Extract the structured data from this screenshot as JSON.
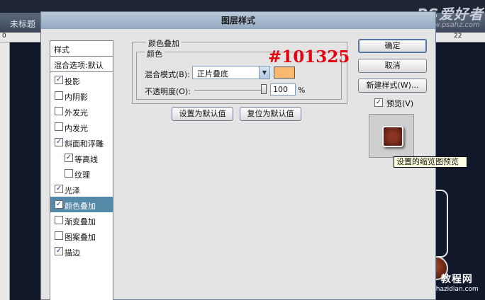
{
  "background": {
    "tab_title": "未标题",
    "ruler_left_mark": "0",
    "ruler_right_mark": "22",
    "logo_text": "PS爱好者",
    "logo_sub": "www.psahz.com",
    "watermark_line1": "查字典 教程网",
    "watermark_line2": "jiaocheng.chazidian.com"
  },
  "dialog": {
    "title": "图层样式",
    "style_list": {
      "header": "样式",
      "blend_options": "混合选项:默认",
      "items": [
        {
          "label": "投影",
          "checked": true,
          "sub": false,
          "selected": false
        },
        {
          "label": "内阴影",
          "checked": false,
          "sub": false,
          "selected": false
        },
        {
          "label": "外发光",
          "checked": false,
          "sub": false,
          "selected": false
        },
        {
          "label": "内发光",
          "checked": false,
          "sub": false,
          "selected": false
        },
        {
          "label": "斜面和浮雕",
          "checked": true,
          "sub": false,
          "selected": false
        },
        {
          "label": "等高线",
          "checked": true,
          "sub": true,
          "selected": false
        },
        {
          "label": "纹理",
          "checked": false,
          "sub": true,
          "selected": false
        },
        {
          "label": "光泽",
          "checked": true,
          "sub": false,
          "selected": false
        },
        {
          "label": "颜色叠加",
          "checked": true,
          "sub": false,
          "selected": true
        },
        {
          "label": "渐变叠加",
          "checked": false,
          "sub": false,
          "selected": false
        },
        {
          "label": "图案叠加",
          "checked": false,
          "sub": false,
          "selected": false
        },
        {
          "label": "描边",
          "checked": true,
          "sub": false,
          "selected": false
        }
      ]
    },
    "panel": {
      "title": "颜色叠加",
      "group_title": "颜色",
      "blend_mode_label": "混合模式(B):",
      "blend_mode_value": "正片叠底",
      "swatch_color": "#fbb86f",
      "opacity_label": "不透明度(O):",
      "opacity_value": "100",
      "opacity_unit": "%",
      "opacity_level": 1.0,
      "annotation": "#101325",
      "set_default": "设置为默认值",
      "reset_default": "复位为默认值"
    },
    "buttons": {
      "ok": "确定",
      "cancel": "取消",
      "new_style": "新建样式(W)...",
      "preview_label": "预览(V)",
      "preview_checked": true
    },
    "thumbnail_tooltip": "设置的缩览图预览"
  },
  "colors": {
    "selected_row": "#5489a8",
    "annotation_red": "#e8000e",
    "canvas_bg": "#11182a"
  }
}
